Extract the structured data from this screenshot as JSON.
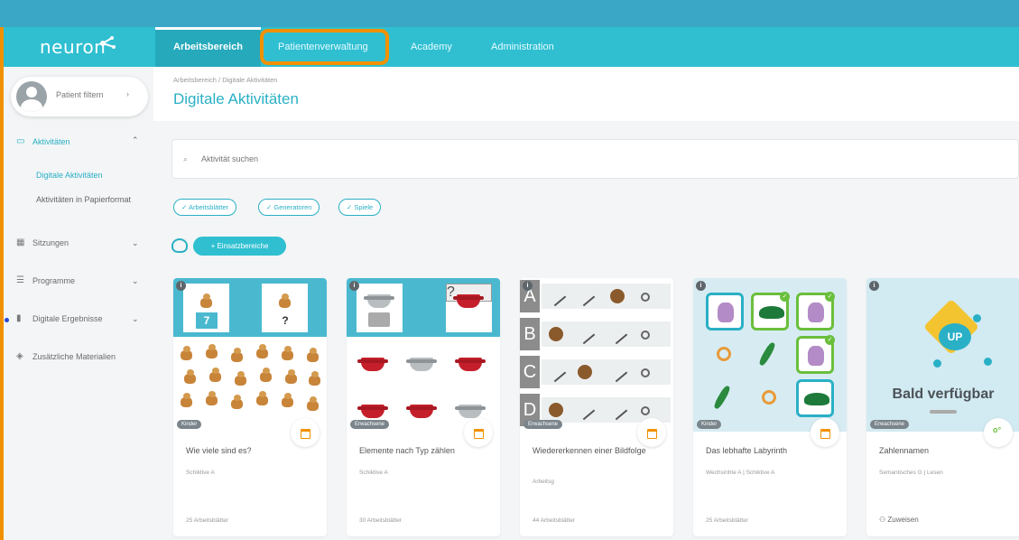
{
  "app": {
    "logo_text": "neuron"
  },
  "nav": {
    "tabs": [
      {
        "label": "Arbeitsbereich",
        "active": true
      },
      {
        "label": "Patientenverwaltung",
        "highlighted": true
      },
      {
        "label": "Academy"
      },
      {
        "label": "Administration"
      }
    ]
  },
  "sidebar": {
    "patient_filter": "Patient filtern",
    "items": [
      {
        "label": "Aktivitäten",
        "icon": "activities-icon",
        "active": true
      },
      {
        "label": "Sitzungen",
        "icon": "calendar-icon"
      },
      {
        "label": "Programme",
        "icon": "list-icon"
      },
      {
        "label": "Digitale Ergebnisse",
        "icon": "bar-chart-icon"
      },
      {
        "label": "Zusätzliche Materialien",
        "icon": "layers-icon"
      }
    ],
    "subitems": [
      {
        "label": "Digitale Aktivitäten",
        "active": true
      },
      {
        "label": "Aktivitäten in Papierformat"
      }
    ]
  },
  "header": {
    "breadcrumb": "Arbeitsbereich / Digitale Aktivitäten",
    "title": "Digitale Aktivitäten"
  },
  "search": {
    "placeholder": "Aktivität suchen"
  },
  "filters": [
    {
      "label": "✓ Arbeitsblätter"
    },
    {
      "label": "✓ Generatoren"
    },
    {
      "label": "✓ Spiele"
    }
  ],
  "areas_button": "+ Einsatzbereiche",
  "cards": [
    {
      "tag": "Kinder",
      "title": "Wie viele sind es?",
      "subtitle": "Schiktive A",
      "count": "25 Arbeitsblätter",
      "thumb_num": "7",
      "thumb_q": "?"
    },
    {
      "tag": "Erwachsene",
      "title": "Elemente nach Typ zählen",
      "subtitle": "Schiktive A",
      "count": "30 Arbeitsblätter",
      "thumb_q": "?"
    },
    {
      "tag": "Erwachsene",
      "title": "Wiedererkennen einer Bildfolge",
      "subtitle": "Arbeitsg",
      "count": "44 Arbeitsblätter",
      "letters": [
        "A",
        "B",
        "C",
        "D"
      ]
    },
    {
      "tag": "Kinder",
      "title": "Das lebhafte Labyrinth",
      "subtitle": "Wechsinhte A | Schiktive A",
      "count": "25 Arbeitsblätter"
    },
    {
      "tag": "Erwachsene",
      "title": "Zahlennamen",
      "subtitle": "Semantisches G | Lesen",
      "assign": "Zuweisen",
      "soon": "Bald verfügbar",
      "up": "UP"
    }
  ],
  "colors": {
    "accent": "#2fbfd1",
    "highlight": "#f29100",
    "nav_bg": "#2fbfd1",
    "top_strip": "#3aa7c7"
  }
}
